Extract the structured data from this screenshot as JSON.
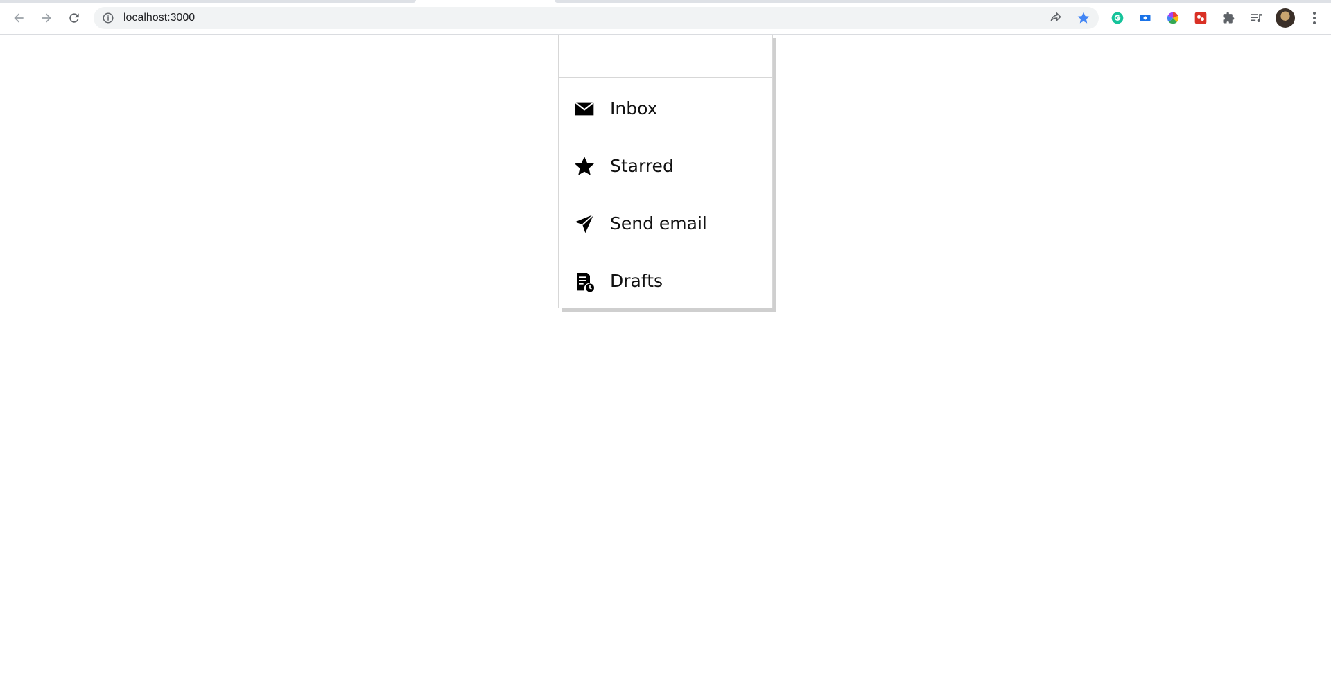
{
  "browser": {
    "url": "localhost:3000",
    "accent": "#4285f4",
    "extensions": [
      "grammarly-icon",
      "screen-capture-icon",
      "color-picker-icon",
      "puzzle-game-icon",
      "extensions-icon",
      "media-queue-icon"
    ]
  },
  "menu": {
    "header_title": "",
    "items": [
      {
        "label": "Inbox",
        "icon": "mail-icon"
      },
      {
        "label": "Starred",
        "icon": "star-icon"
      },
      {
        "label": "Send email",
        "icon": "send-icon"
      },
      {
        "label": "Drafts",
        "icon": "drafts-icon"
      }
    ]
  }
}
